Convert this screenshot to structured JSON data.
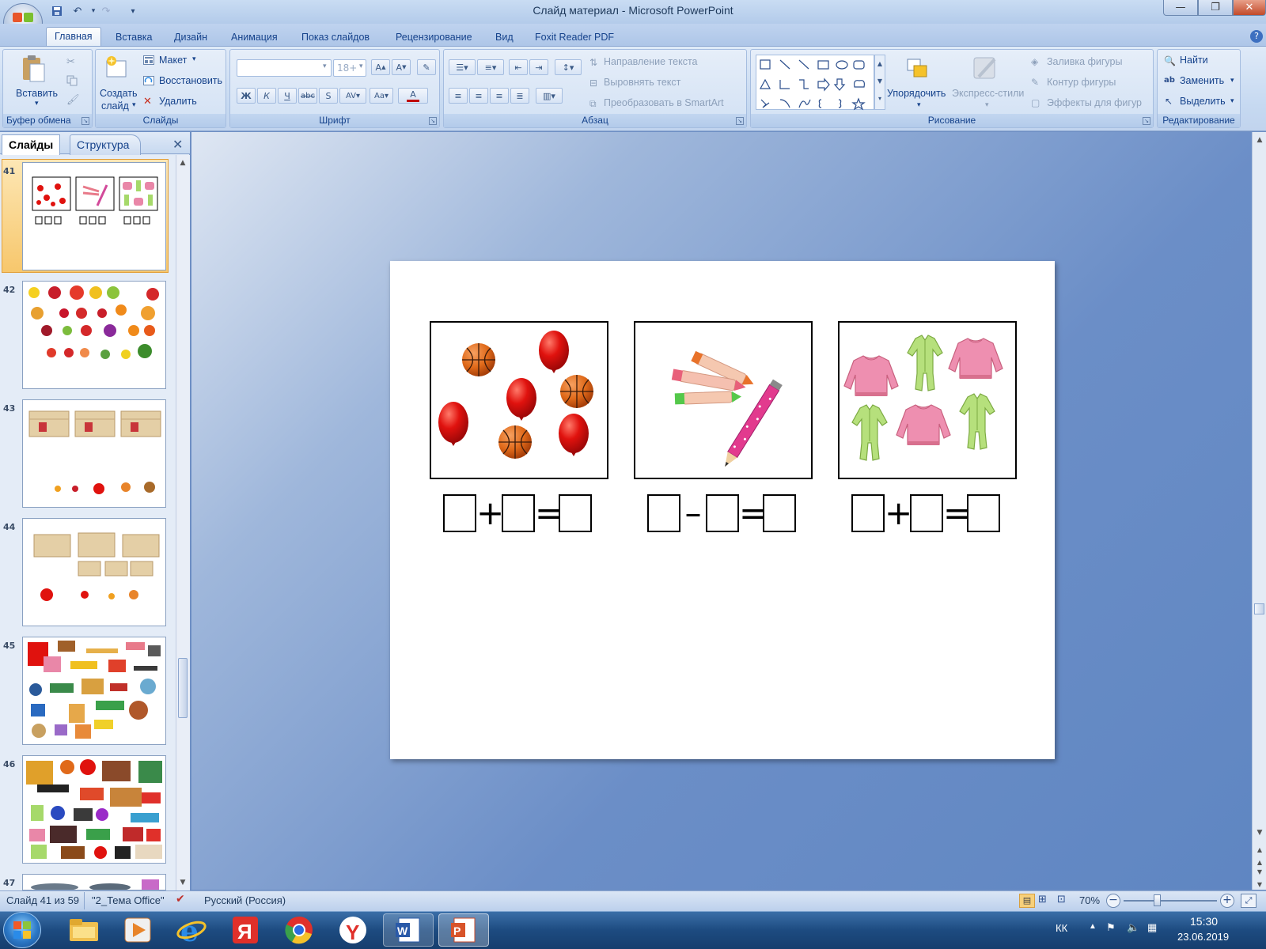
{
  "window": {
    "title": "Слайд материал - Microsoft PowerPoint"
  },
  "tabs": [
    "Главная",
    "Вставка",
    "Дизайн",
    "Анимация",
    "Показ слайдов",
    "Рецензирование",
    "Вид",
    "Foxit Reader PDF"
  ],
  "ribbon": {
    "clipboard": {
      "label": "Буфер обмена",
      "paste": "Вставить"
    },
    "slides": {
      "label": "Слайды",
      "new_slide_1": "Создать",
      "new_slide_2": "слайд",
      "layout": "Макет",
      "reset": "Восстановить",
      "delete": "Удалить"
    },
    "font": {
      "label": "Шрифт",
      "size": "18+"
    },
    "paragraph": {
      "label": "Абзац",
      "text_direction": "Направление текста",
      "align_text": "Выровнять текст",
      "smartart": "Преобразовать в SmartArt"
    },
    "drawing": {
      "label": "Рисование",
      "arrange": "Упорядочить",
      "quick_styles": "Экспресс-стили",
      "fill": "Заливка фигуры",
      "outline": "Контур фигуры",
      "effects": "Эффекты для фигур"
    },
    "editing": {
      "label": "Редактирование",
      "find": "Найти",
      "replace": "Заменить",
      "select": "Выделить"
    }
  },
  "pane": {
    "tab_slides": "Слайды",
    "tab_outline": "Структура",
    "thumbnails": [
      {
        "num": "41",
        "selected": true
      },
      {
        "num": "42"
      },
      {
        "num": "43"
      },
      {
        "num": "44"
      },
      {
        "num": "45"
      },
      {
        "num": "46"
      },
      {
        "num": "47"
      }
    ]
  },
  "slide": {
    "equations": [
      {
        "op1": "+",
        "op2": "="
      },
      {
        "op1": "–",
        "op2": "="
      },
      {
        "op1": "+",
        "op2": "="
      }
    ]
  },
  "status": {
    "slide_info": "Слайд 41 из 59",
    "theme": "\"2_Тема Office\"",
    "language": "Русский (Россия)",
    "zoom": "70%"
  },
  "taskbar": {
    "lang": "КК",
    "time": "15:30",
    "date": "23.06.2019"
  },
  "colors": {
    "accent": "#15428b",
    "ribbon": "#c6d9f1",
    "balloon": "#e0120e",
    "ball": "#e06a1a"
  }
}
